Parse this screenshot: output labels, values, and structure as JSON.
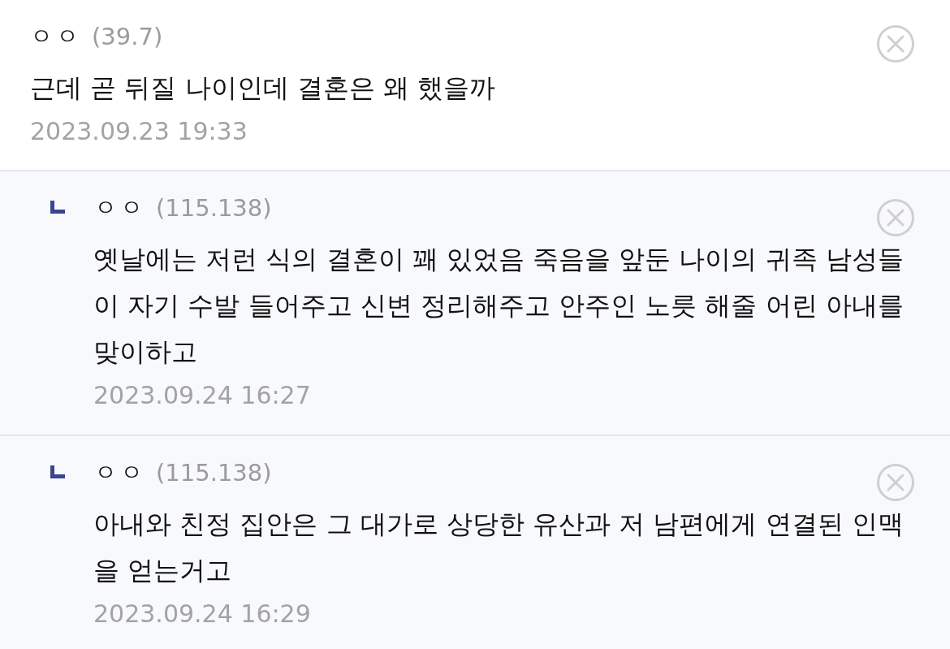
{
  "comments": [
    {
      "kind": "comment",
      "nickname": "ㅇㅇ",
      "ip": "(39.7)",
      "text": "근데 곧 뒤질 나이인데 결혼은 왜 했을까",
      "date": "2023.09.23 19:33"
    },
    {
      "kind": "reply",
      "nickname": "ㅇㅇ",
      "ip": "(115.138)",
      "text": "옛날에는 저런 식의 결혼이 꽤 있었음 죽음을 앞둔 나이의 귀족 남성들이 자기 수발 들어주고 신변 정리해주고 안주인 노릇 해줄 어린 아내를 맞이하고",
      "date": "2023.09.24 16:27"
    },
    {
      "kind": "reply",
      "nickname": "ㅇㅇ",
      "ip": "(115.138)",
      "text": "아내와 친정 집안은 그 대가로 상당한 유산과 저 남편에게 연결된 인맥을 얻는거고",
      "date": "2023.09.24 16:29"
    }
  ]
}
